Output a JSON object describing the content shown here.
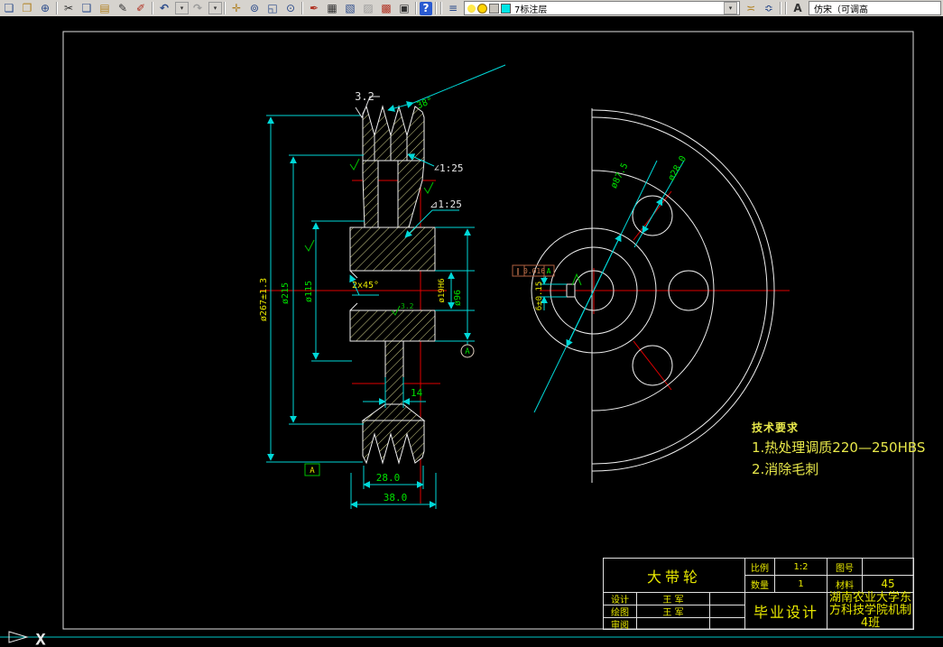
{
  "toolbar": {
    "layer_combo": {
      "value": "7标注层"
    },
    "font_combo": {
      "value": "仿宋（可调高"
    },
    "icons": [
      {
        "name": "preview-icon",
        "glyph": "❏"
      },
      {
        "name": "publish-icon",
        "glyph": "❐"
      },
      {
        "name": "etransmit-icon",
        "glyph": "⊕"
      },
      {
        "name": "cut-icon",
        "glyph": "✂"
      },
      {
        "name": "copy-icon",
        "glyph": "❑"
      },
      {
        "name": "paste-icon",
        "glyph": "▤"
      },
      {
        "name": "match-properties-icon",
        "glyph": "✎"
      },
      {
        "name": "redline-icon",
        "glyph": "✐"
      },
      {
        "name": "undo-icon",
        "glyph": "↶"
      },
      {
        "name": "redo-icon",
        "glyph": "↷"
      },
      {
        "name": "pan-icon",
        "glyph": "✛"
      },
      {
        "name": "zoom-realtime-icon",
        "glyph": "⊚"
      },
      {
        "name": "zoom-window-icon",
        "glyph": "◱"
      },
      {
        "name": "zoom-previous-icon",
        "glyph": "⊙"
      },
      {
        "name": "sketch-icon",
        "glyph": "✒"
      },
      {
        "name": "layer-manager-icon",
        "glyph": "▦"
      },
      {
        "name": "layer-translate-icon",
        "glyph": "▧"
      },
      {
        "name": "render-icon",
        "glyph": "▨"
      },
      {
        "name": "markup-icon",
        "glyph": "▩"
      },
      {
        "name": "calculator-icon",
        "glyph": "▣"
      },
      {
        "name": "help-icon",
        "glyph": "?"
      },
      {
        "name": "layers-icon",
        "glyph": "≡"
      },
      {
        "name": "make-layer-current-icon",
        "glyph": "≍"
      },
      {
        "name": "layer-previous-icon",
        "glyph": "≎"
      },
      {
        "name": "text-style-icon",
        "glyph": "A"
      }
    ]
  },
  "drawing": {
    "left_view": {
      "roughness_top": "3.2",
      "groove_angle": "38°",
      "taper_upper": "∠1:25",
      "taper_lower": "⊿1:25",
      "dia_outer": "ø267±1.3",
      "dia_rim_inner": "ø215",
      "dia_web": "ø115",
      "chamfer": "2x45°",
      "dia_bore": "ø19H6",
      "dia_hub": "ø96",
      "web_thickness": "14",
      "rim_width": "28.0",
      "total_width": "38.0",
      "bore_roughness": "3.2",
      "datum": "A"
    },
    "right_view": {
      "dia_web_circle": "ø87.5",
      "dia_hole": "ø28.0",
      "keyway_width": "6±0.15",
      "fcf": {
        "symbol": "∥",
        "value": "0.016",
        "datum": "A"
      },
      "datum_balloon": "A"
    },
    "tech_requirements": {
      "title": "技术要求",
      "item1": "1.热处理调质220—250HBS",
      "item2": "2.消除毛刺"
    }
  },
  "title_block": {
    "part_name": "大带轮",
    "scale_label": "比例",
    "scale_value": "1:2",
    "qty_label": "数量",
    "qty_value": "1",
    "drawing_no_label": "图号",
    "material_label": "材料",
    "material_value": "45",
    "design_label": "设计",
    "design_value": "王 军",
    "draft_label": "绘图",
    "draft_value": "王 军",
    "review_label": "审阅",
    "project": "毕业设计",
    "school": "湖南农业大学东方科技学院机制4班"
  },
  "status": {
    "ucs_x": "X"
  },
  "colors": {
    "dimension": "#00d8d8",
    "centerline": "#e00000",
    "hatch": "#cfcf8a",
    "text_green": "#00e000",
    "text_yellow": "#e6e600",
    "geometry": "#efefef"
  }
}
